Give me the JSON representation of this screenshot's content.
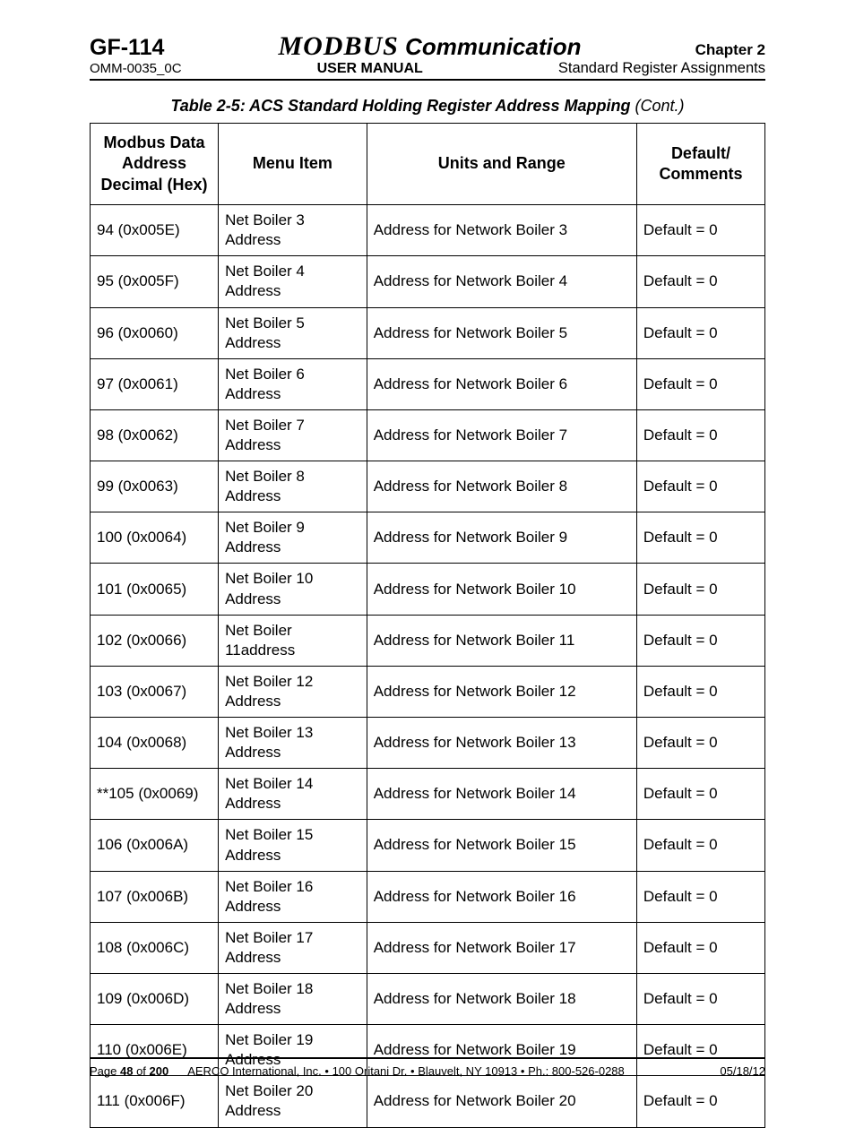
{
  "header": {
    "gf": "GF-114",
    "title_modbus": "MODBUS",
    "title_comm": " Communication",
    "chapter": "Chapter 2",
    "omm": "OMM-0035_0C",
    "user_manual": "USER MANUAL",
    "subtitle": "Standard Register Assignments"
  },
  "table": {
    "title_main": "Table 2-5:  ACS Standard Holding Register Address Mapping ",
    "title_cont": "(Cont.)",
    "headers": {
      "addr": "Modbus Data Address Decimal (Hex)",
      "menu": "Menu Item",
      "units": "Units and Range",
      "default": "Default/ Comments"
    },
    "rows": [
      {
        "addr": "94 (0x005E)",
        "menu": "Net Boiler 3 Address",
        "units": "Address for Network Boiler 3",
        "default": "Default = 0"
      },
      {
        "addr": "95 (0x005F)",
        "menu": "Net Boiler 4 Address",
        "units": "Address for Network Boiler 4",
        "default": "Default = 0"
      },
      {
        "addr": "96 (0x0060)",
        "menu": "Net Boiler 5 Address",
        "units": "Address for Network Boiler 5",
        "default": "Default = 0"
      },
      {
        "addr": "97 (0x0061)",
        "menu": "Net Boiler 6 Address",
        "units": "Address for Network Boiler 6",
        "default": "Default = 0"
      },
      {
        "addr": "98 (0x0062)",
        "menu": "Net Boiler 7 Address",
        "units": "Address for Network Boiler 7",
        "default": "Default = 0"
      },
      {
        "addr": "99 (0x0063)",
        "menu": "Net Boiler 8 Address",
        "units": "Address for Network Boiler 8",
        "default": "Default = 0"
      },
      {
        "addr": "100 (0x0064)",
        "menu": "Net Boiler 9 Address",
        "units": "Address for Network Boiler 9",
        "default": "Default = 0"
      },
      {
        "addr": "101 (0x0065)",
        "menu": "Net Boiler 10 Address",
        "units": "Address for Network Boiler 10",
        "default": "Default = 0"
      },
      {
        "addr": "102 (0x0066)",
        "menu": "Net Boiler 11address",
        "units": "Address for Network Boiler 11",
        "default": "Default = 0"
      },
      {
        "addr": "103 (0x0067)",
        "menu": "Net Boiler 12 Address",
        "units": "Address for Network Boiler 12",
        "default": "Default = 0"
      },
      {
        "addr": "104 (0x0068)",
        "menu": "Net Boiler 13 Address",
        "units": "Address for Network Boiler 13",
        "default": "Default = 0"
      },
      {
        "addr": "**105 (0x0069)",
        "menu": "Net Boiler 14 Address",
        "units": "Address for Network Boiler 14",
        "default": "Default = 0"
      },
      {
        "addr": "106 (0x006A)",
        "menu": "Net Boiler 15 Address",
        "units": "Address for Network Boiler 15",
        "default": "Default = 0"
      },
      {
        "addr": "107 (0x006B)",
        "menu": "Net Boiler 16 Address",
        "units": "Address for Network Boiler 16",
        "default": "Default = 0"
      },
      {
        "addr": "108 (0x006C)",
        "menu": "Net Boiler 17 Address",
        "units": "Address for Network Boiler 17",
        "default": "Default = 0"
      },
      {
        "addr": "109 (0x006D)",
        "menu": "Net Boiler 18 Address",
        "units": "Address for Network Boiler 18",
        "default": "Default = 0"
      },
      {
        "addr": "110 (0x006E)",
        "menu": "Net Boiler 19 Address",
        "units": "Address for Network Boiler 19",
        "default": "Default = 0"
      },
      {
        "addr": "111 (0x006F)",
        "menu": "Net Boiler 20 Address",
        "units": "Address for Network Boiler 20",
        "default": "Default = 0"
      }
    ]
  },
  "footer": {
    "page_prefix": "Page ",
    "page_num": "48",
    "page_of": " of ",
    "page_total": "200",
    "company": "AERCO International, Inc. ",
    "bullet": "•",
    "addr": " 100 Oritani Dr. ",
    "city": " Blauvelt, NY 10913 ",
    "phone": " Ph.: 800-526-0288",
    "date": "05/18/12"
  }
}
